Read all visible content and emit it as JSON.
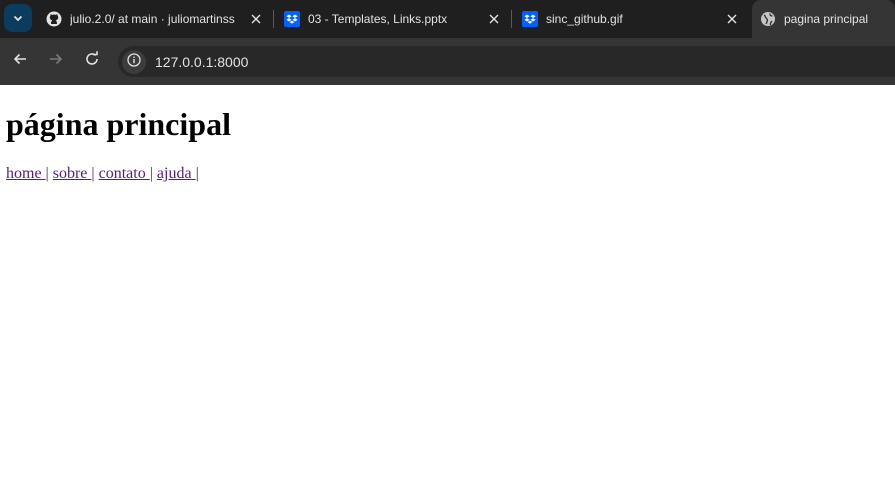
{
  "browser": {
    "tabs": [
      {
        "title": "julio.2.0/ at main · juliomartinss",
        "icon": "github-icon",
        "active": false
      },
      {
        "title": "03 - Templates, Links.pptx",
        "icon": "dropbox-icon",
        "active": false
      },
      {
        "title": "sinc_github.gif",
        "icon": "dropbox-icon",
        "active": false
      },
      {
        "title": "pagina principal",
        "icon": "globe-icon",
        "active": true
      }
    ],
    "url": "127.0.0.1:8000"
  },
  "page": {
    "heading": "página principal",
    "links": [
      {
        "label": "home ",
        "sep": "|"
      },
      {
        "label": "sobre ",
        "sep": "|"
      },
      {
        "label": "contato ",
        "sep": "|"
      },
      {
        "label": "ajuda ",
        "sep": "|"
      }
    ]
  },
  "colors": {
    "link_visited": "#551a8b",
    "tabstrip": "#1f1f1f",
    "toolbar": "#353535"
  }
}
